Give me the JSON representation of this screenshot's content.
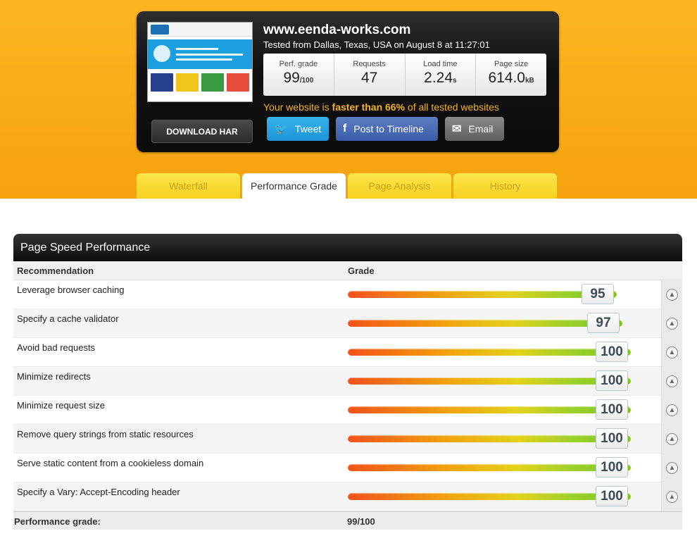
{
  "header": {
    "site": "www.eenda-works.com",
    "tested": "Tested from Dallas, Texas, USA on August 8 at 11:27:01",
    "metrics": [
      {
        "label": "Perf. grade",
        "value": "99",
        "unit": "/100"
      },
      {
        "label": "Requests",
        "value": "47",
        "unit": ""
      },
      {
        "label": "Load time",
        "value": "2.24",
        "unit": "s"
      },
      {
        "label": "Page size",
        "value": "614.0",
        "unit": "kB"
      }
    ],
    "faster_pre": "Your website is ",
    "faster_bold": "faster than 66%",
    "faster_post": " of all tested websites",
    "download_label": "DOWNLOAD HAR",
    "tweet_label": "Tweet",
    "timeline_label": "Post to Timeline",
    "email_label": "Email"
  },
  "tabs": [
    {
      "label": "Waterfall"
    },
    {
      "label": "Performance Grade"
    },
    {
      "label": "Page Analysis"
    },
    {
      "label": "History"
    }
  ],
  "panel": {
    "title": "Page Speed Performance",
    "col_recommendation": "Recommendation",
    "col_grade": "Grade",
    "rows": [
      {
        "name": "Leverage browser caching",
        "grade": 95
      },
      {
        "name": "Specify a cache validator",
        "grade": 97
      },
      {
        "name": "Avoid bad requests",
        "grade": 100
      },
      {
        "name": "Minimize redirects",
        "grade": 100
      },
      {
        "name": "Minimize request size",
        "grade": 100
      },
      {
        "name": "Remove query strings from static resources",
        "grade": 100
      },
      {
        "name": "Serve static content from a cookieless domain",
        "grade": 100
      },
      {
        "name": "Specify a Vary: Accept-Encoding header",
        "grade": 100
      }
    ],
    "footer_label": "Performance grade:",
    "footer_value": "99/100"
  }
}
